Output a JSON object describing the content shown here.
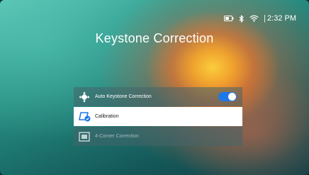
{
  "status_bar": {
    "time": "2:32 PM",
    "separator": "|",
    "icons": [
      "battery-icon",
      "bluetooth-icon",
      "wifi-icon"
    ]
  },
  "page": {
    "title": "Keystone Correction"
  },
  "menu": {
    "items": [
      {
        "label": "Auto Keystone Correction",
        "icon": "auto-keystone-icon",
        "toggle_on": true
      },
      {
        "label": "Calibration",
        "icon": "calibration-icon",
        "selected": true
      },
      {
        "label": "4-Corner Correction",
        "icon": "four-corner-icon",
        "disabled": true
      }
    ]
  },
  "colors": {
    "accent": "#1f78e8",
    "selected_row": "#ffffff"
  }
}
